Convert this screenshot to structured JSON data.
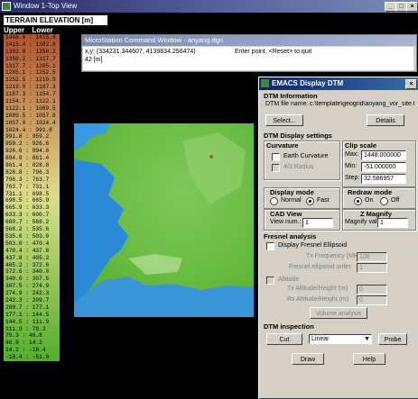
{
  "main_window": {
    "title": "Window 1-Top View"
  },
  "legend": {
    "title": "TERRAIN ELEVATION [m]",
    "col_upper": "Upper",
    "col_lower": "Lower",
    "rows": [
      {
        "text": "1448.0 : 1415.4",
        "color": "#b25632"
      },
      {
        "text": "1415.4 : 1382.8",
        "color": "#b45c36"
      },
      {
        "text": "1382.8 : 1350.2",
        "color": "#b6623a"
      },
      {
        "text": "1350.2 : 1317.7",
        "color": "#b8683e"
      },
      {
        "text": "1317.7 : 1285.1",
        "color": "#ba6e42"
      },
      {
        "text": "1285.1 : 1252.5",
        "color": "#bc7446"
      },
      {
        "text": "1252.5 : 1219.9",
        "color": "#be7a4a"
      },
      {
        "text": "1219.9 : 1187.3",
        "color": "#c0804e"
      },
      {
        "text": "1187.3 : 1154.7",
        "color": "#c28652"
      },
      {
        "text": "1154.7 : 1122.1",
        "color": "#c48c56"
      },
      {
        "text": "1122.1 : 1089.5",
        "color": "#c6925a"
      },
      {
        "text": "1089.5 : 1057.0",
        "color": "#c8985e"
      },
      {
        "text": "1057.0 : 1024.4",
        "color": "#ca9e62"
      },
      {
        "text": "1024.4 : 991.8",
        "color": "#cca466"
      },
      {
        "text": "991.8 : 959.2",
        "color": "#ceaa6a"
      },
      {
        "text": "959.2 : 926.6",
        "color": "#d0b06e"
      },
      {
        "text": "926.6 : 894.0",
        "color": "#d2b672"
      },
      {
        "text": "894.0 : 861.4",
        "color": "#d4bc76"
      },
      {
        "text": "861.4 : 828.8",
        "color": "#d6c27a"
      },
      {
        "text": "828.8 : 796.3",
        "color": "#d8c87e"
      },
      {
        "text": "796.3 : 763.7",
        "color": "#dace82"
      },
      {
        "text": "763.7 : 731.1",
        "color": "#dcd486"
      },
      {
        "text": "731.1 : 698.5",
        "color": "#dcd888"
      },
      {
        "text": "698.5 : 665.9",
        "color": "#d8da86"
      },
      {
        "text": "665.9 : 633.3",
        "color": "#d2da82"
      },
      {
        "text": "633.3 : 600.7",
        "color": "#ccd87e"
      },
      {
        "text": "600.7 : 568.2",
        "color": "#c6d67a"
      },
      {
        "text": "568.2 : 535.6",
        "color": "#c0d476"
      },
      {
        "text": "535.6 : 503.0",
        "color": "#bad272"
      },
      {
        "text": "503.0 : 470.4",
        "color": "#b4d06e"
      },
      {
        "text": "470.4 : 437.8",
        "color": "#aece6a"
      },
      {
        "text": "437.8 : 405.2",
        "color": "#a8cc66"
      },
      {
        "text": "405.2 : 372.6",
        "color": "#a2ca62"
      },
      {
        "text": "372.6 : 340.0",
        "color": "#9cc85e"
      },
      {
        "text": "340.0 : 307.5",
        "color": "#96c65a"
      },
      {
        "text": "307.5 : 274.9",
        "color": "#90c456"
      },
      {
        "text": "274.9 : 242.3",
        "color": "#8ac252"
      },
      {
        "text": "242.3 : 209.7",
        "color": "#84c04e"
      },
      {
        "text": "209.7 : 177.1",
        "color": "#7ebe4a"
      },
      {
        "text": "177.1 : 144.5",
        "color": "#78bc46"
      },
      {
        "text": "144.5 : 111.9",
        "color": "#72ba42"
      },
      {
        "text": "111.9 : 79.3",
        "color": "#6cb83e"
      },
      {
        "text": "79.3 : 46.8",
        "color": "#66b63a"
      },
      {
        "text": "46.8 : 14.2",
        "color": "#60b436"
      },
      {
        "text": "14.2 : -18.4",
        "color": "#5ab232"
      },
      {
        "text": "-18.4 : -51.0",
        "color": "#54b02e"
      }
    ]
  },
  "command_window": {
    "title": "MicroStation Command Window - anyang.dgn",
    "coords": "x,y: (334231.344607, 4139834.256474)",
    "value": "42  [m]",
    "prompt": "Enter point, <Reset> to quit"
  },
  "emacs": {
    "title": "EMACS Display DTM",
    "dtm_info": {
      "heading": "DTM Information",
      "file_label": "DTM file name:",
      "file_value": "c:\\template\\geogrid\\anyang_vor_site.t",
      "select_btn": "Select...",
      "details_btn": "Details"
    },
    "display_settings": {
      "heading": "DTM Display settings",
      "curvature_title": "Curvature",
      "earth_curvature": "Earth Curvature",
      "four_thirds": "4/3 Radius",
      "clip_title": "Clip scale",
      "max_label": "Max:",
      "max_value": "1448.000000",
      "min_label": "Min:",
      "min_value": "-51.000000",
      "step_label": "Step:",
      "step_value": "32.586957",
      "display_mode_title": "Display mode",
      "normal": "Normal",
      "fast": "Fast",
      "redraw_title": "Redraw mode",
      "on": "On",
      "off": "Off",
      "cad_title": "CAD View",
      "view_num_label": "View num.:",
      "view_num_value": "1",
      "zmag_title": "Z Magnify",
      "magnify_label": "Magnify val.:",
      "magnify_value": "1"
    },
    "fresnel": {
      "heading": "Fresnel analysis",
      "display_ellipsoid": "Display Fresnel Ellipsoid",
      "tx_freq_label": "Tx Frequency (MHz)",
      "tx_freq_value": "100",
      "order_label": "Fresnel ellipsoid order",
      "order_value": "1",
      "altitude": "Altitude",
      "tx_alt_label": "Tx Altitude/Height (m)",
      "tx_alt_value": "0",
      "rx_alt_label": "Rx Altitude/Height (m)",
      "rx_alt_value": "0",
      "volume_btn": "Volume analysis"
    },
    "inspection": {
      "heading": "DTM inspection",
      "cut_btn": "Cut",
      "mode_value": "Linear",
      "probe_btn": "Probe"
    },
    "draw_btn": "Draw",
    "help_btn": "Help"
  }
}
